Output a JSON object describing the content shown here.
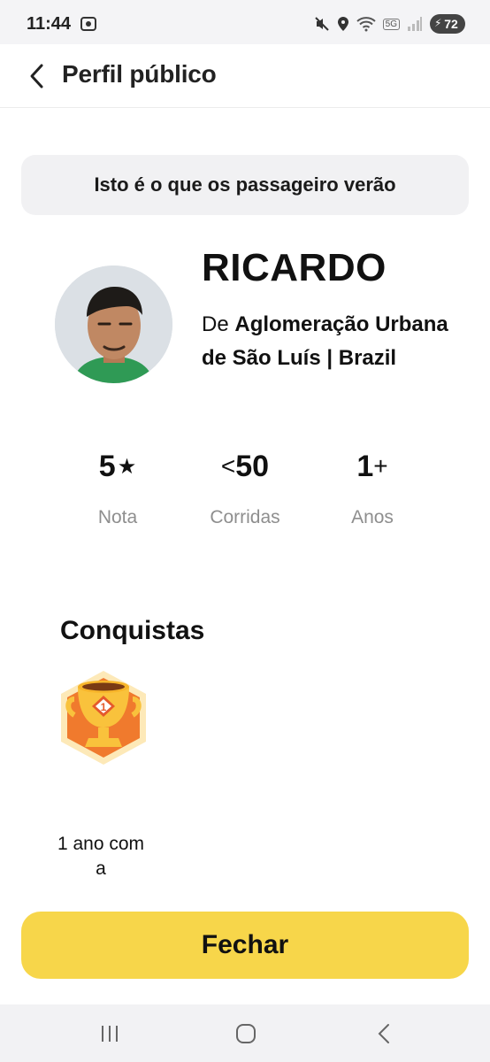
{
  "status": {
    "time": "11:44",
    "battery": "72",
    "network": "5G"
  },
  "header": {
    "title": "Perfil público"
  },
  "banner": {
    "text": "Isto é o que os passageiro verão"
  },
  "profile": {
    "name": "RICARDO",
    "origin_prefix": "De ",
    "origin_place": "Aglomeração Urbana de São Luís | Brazil"
  },
  "stats": [
    {
      "prefix": "",
      "value": "5",
      "suffix": "★",
      "label": "Nota"
    },
    {
      "prefix": "<",
      "value": "50",
      "suffix": "",
      "label": "Corridas"
    },
    {
      "prefix": "",
      "value": "1",
      "suffix": "+",
      "label": "Anos"
    }
  ],
  "achievements": {
    "title": "Conquistas",
    "items": [
      {
        "icon": "trophy-badge-icon",
        "badge_number": "1",
        "caption": "1 ano com a"
      }
    ]
  },
  "actions": {
    "close_label": "Fechar"
  },
  "colors": {
    "accent": "#f7d64a",
    "banner_bg": "#f1f1f3",
    "badge_orange": "#f07a2d",
    "muted_text": "#8e8e8e"
  }
}
